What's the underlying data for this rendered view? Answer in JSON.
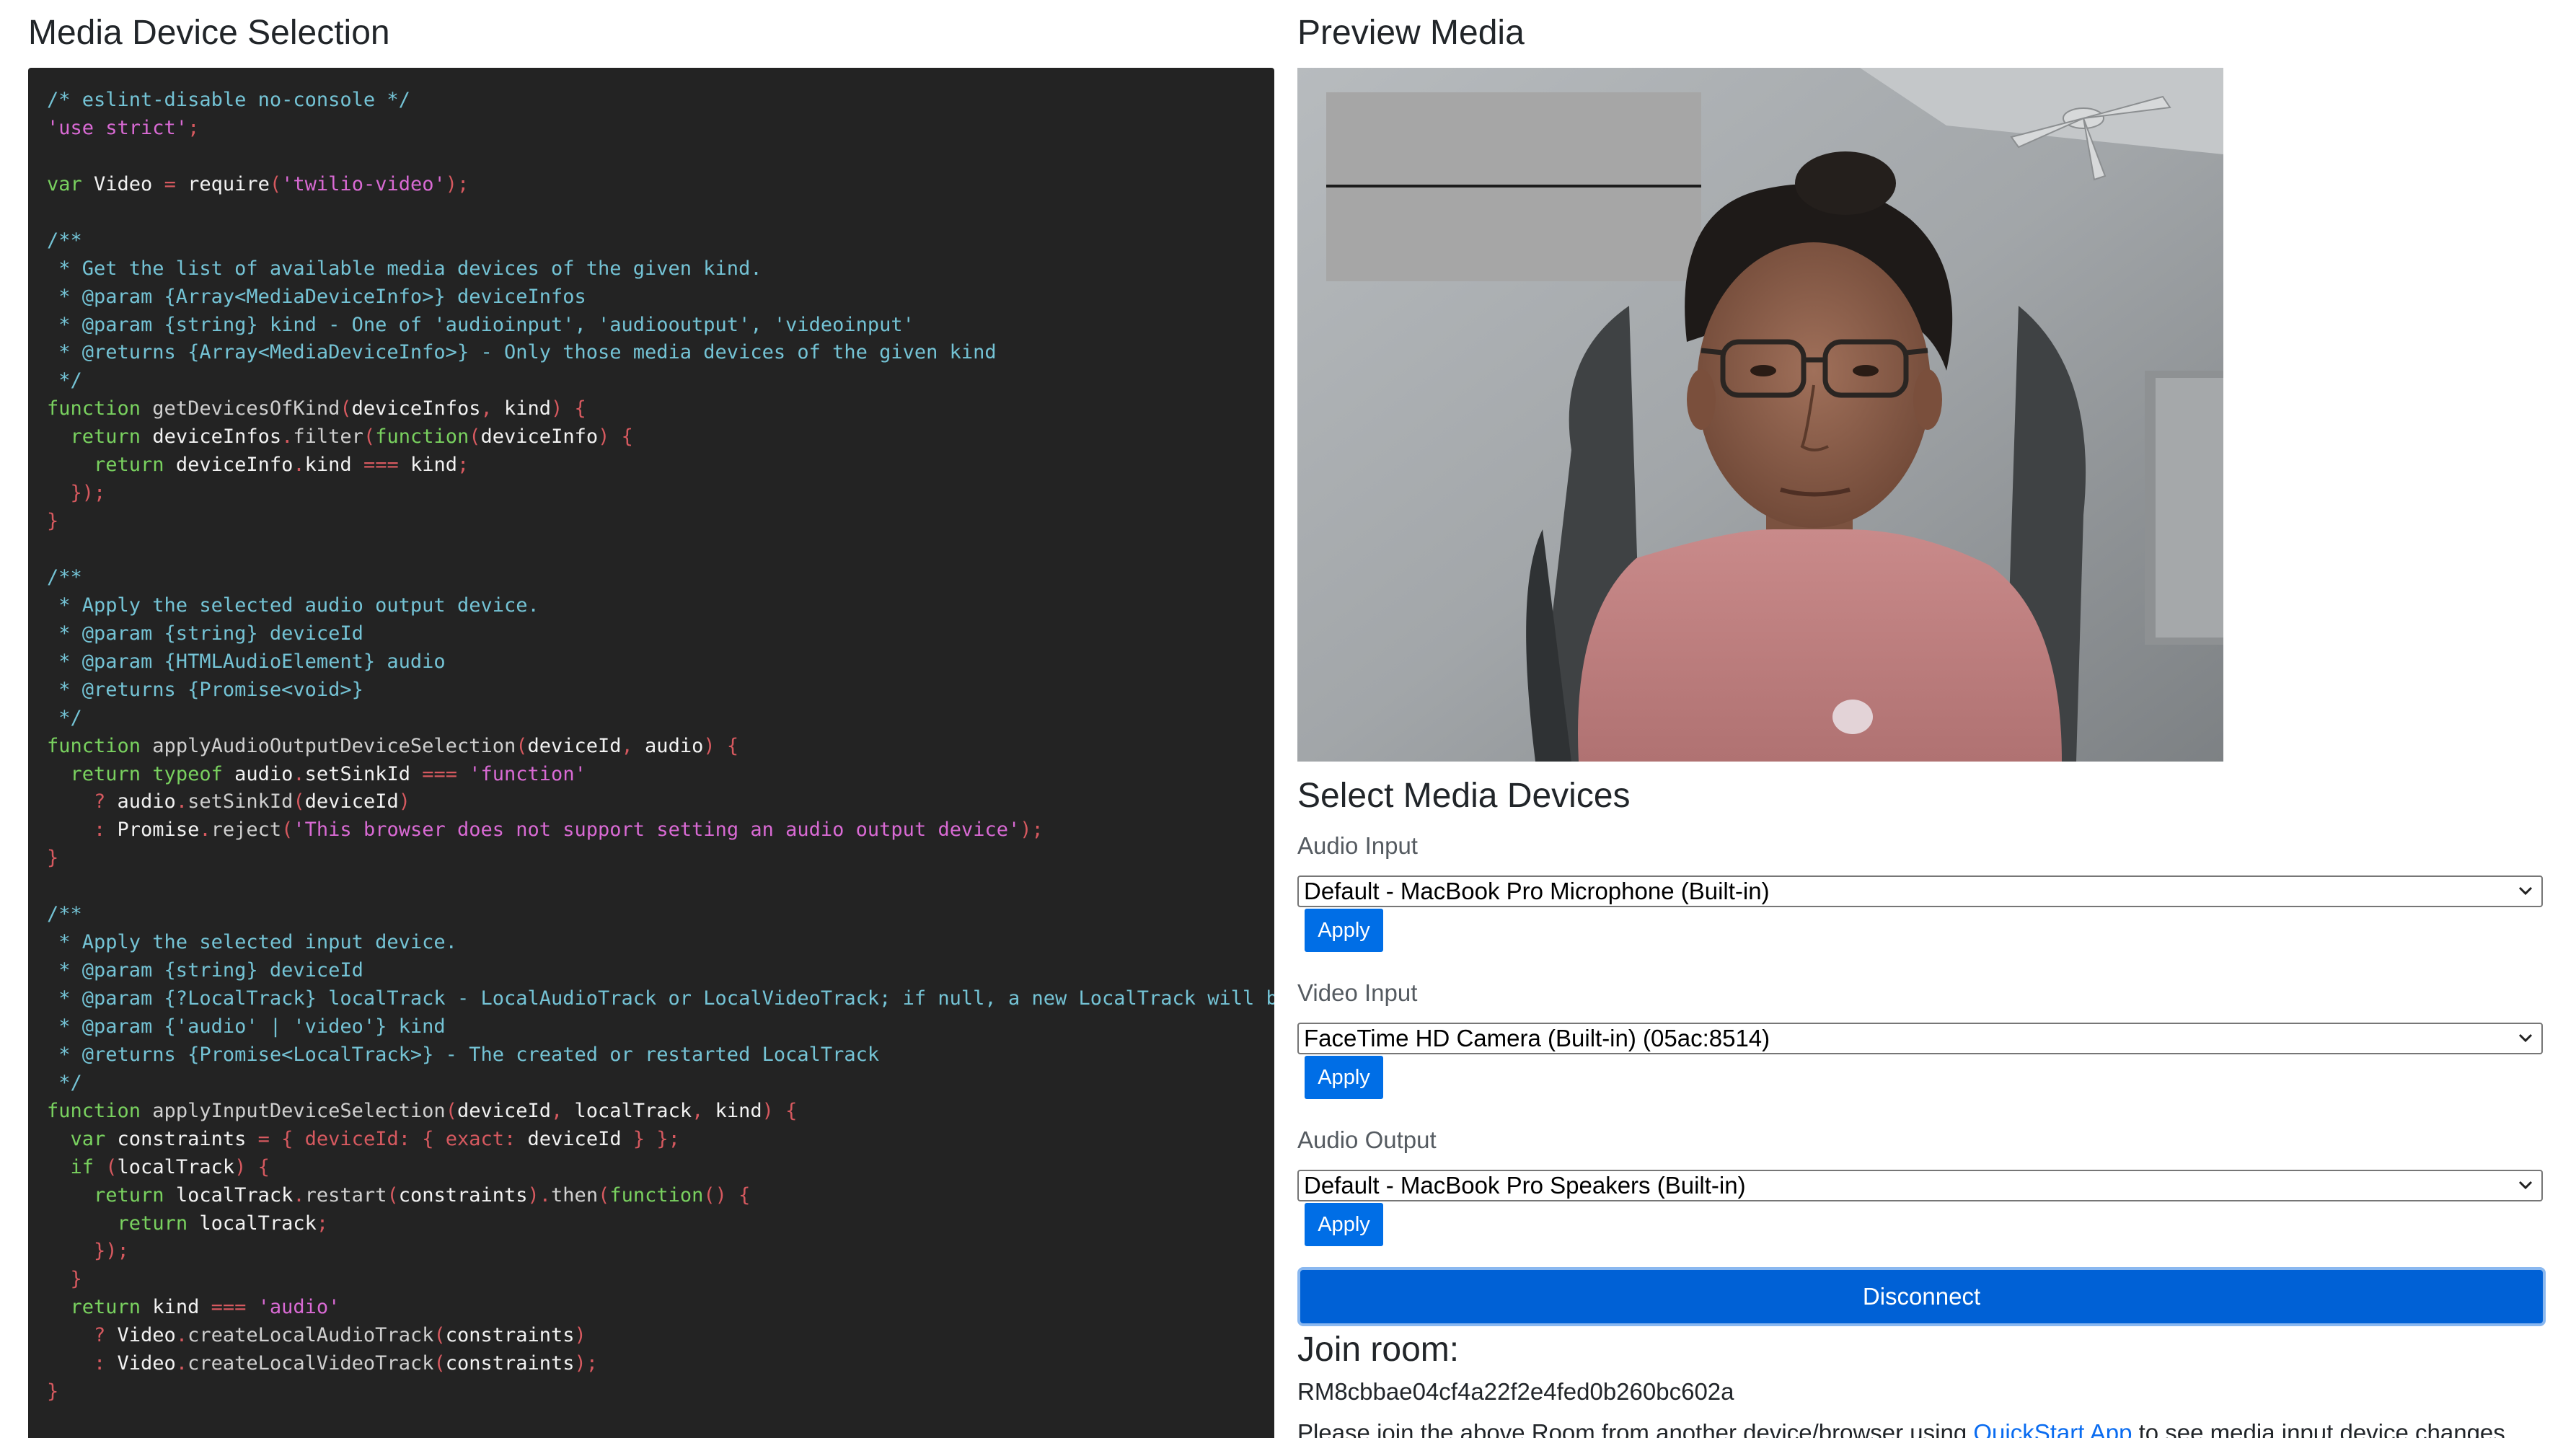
{
  "left": {
    "title": "Media Device Selection",
    "code_lines": [
      [
        [
          "cm",
          "/* eslint-disable no-console */"
        ]
      ],
      [
        [
          "str",
          "'use strict'"
        ],
        [
          "p",
          ";"
        ]
      ],
      [],
      [
        [
          "kw",
          "var"
        ],
        [
          "id",
          " Video "
        ],
        [
          "op",
          "="
        ],
        [
          "id",
          " require"
        ],
        [
          "p",
          "("
        ],
        [
          "str",
          "'twilio-video'"
        ],
        [
          "p",
          ");"
        ]
      ],
      [],
      [
        [
          "cm",
          "/**"
        ]
      ],
      [
        [
          "cm",
          " * Get the list of available media devices of the given kind."
        ]
      ],
      [
        [
          "cm",
          " * @param {Array<MediaDeviceInfo>} deviceInfos"
        ]
      ],
      [
        [
          "cm",
          " * @param {string} kind - One of 'audioinput', 'audiooutput', 'videoinput'"
        ]
      ],
      [
        [
          "cm",
          " * @returns {Array<MediaDeviceInfo>} - Only those media devices of the given kind"
        ]
      ],
      [
        [
          "cm",
          " */"
        ]
      ],
      [
        [
          "kw",
          "function"
        ],
        [
          "fn",
          " getDevicesOfKind"
        ],
        [
          "p",
          "("
        ],
        [
          "id",
          "deviceInfos"
        ],
        [
          "p",
          ","
        ],
        [
          "id",
          " kind"
        ],
        [
          "p",
          ") {"
        ]
      ],
      [
        [
          "id",
          "  "
        ],
        [
          "kw",
          "return"
        ],
        [
          "id",
          " deviceInfos"
        ],
        [
          "p",
          "."
        ],
        [
          "fn",
          "filter"
        ],
        [
          "p",
          "("
        ],
        [
          "kw",
          "function"
        ],
        [
          "p",
          "("
        ],
        [
          "id",
          "deviceInfo"
        ],
        [
          "p",
          ") {"
        ]
      ],
      [
        [
          "id",
          "    "
        ],
        [
          "kw",
          "return"
        ],
        [
          "id",
          " deviceInfo"
        ],
        [
          "p",
          "."
        ],
        [
          "id",
          "kind "
        ],
        [
          "op",
          "==="
        ],
        [
          "id",
          " kind"
        ],
        [
          "p",
          ";"
        ]
      ],
      [
        [
          "p",
          "  });"
        ]
      ],
      [
        [
          "p",
          "}"
        ]
      ],
      [],
      [
        [
          "cm",
          "/**"
        ]
      ],
      [
        [
          "cm",
          " * Apply the selected audio output device."
        ]
      ],
      [
        [
          "cm",
          " * @param {string} deviceId"
        ]
      ],
      [
        [
          "cm",
          " * @param {HTMLAudioElement} audio"
        ]
      ],
      [
        [
          "cm",
          " * @returns {Promise<void>}"
        ]
      ],
      [
        [
          "cm",
          " */"
        ]
      ],
      [
        [
          "kw",
          "function"
        ],
        [
          "fn",
          " applyAudioOutputDeviceSelection"
        ],
        [
          "p",
          "("
        ],
        [
          "id",
          "deviceId"
        ],
        [
          "p",
          ","
        ],
        [
          "id",
          " audio"
        ],
        [
          "p",
          ") {"
        ]
      ],
      [
        [
          "id",
          "  "
        ],
        [
          "kw",
          "return"
        ],
        [
          "kw",
          " typeof"
        ],
        [
          "id",
          " audio"
        ],
        [
          "p",
          "."
        ],
        [
          "id",
          "setSinkId "
        ],
        [
          "op",
          "==="
        ],
        [
          "str",
          " 'function'"
        ]
      ],
      [
        [
          "op",
          "    ?"
        ],
        [
          "id",
          " audio"
        ],
        [
          "p",
          "."
        ],
        [
          "fn",
          "setSinkId"
        ],
        [
          "p",
          "("
        ],
        [
          "id",
          "deviceId"
        ],
        [
          "p",
          ")"
        ]
      ],
      [
        [
          "op",
          "    :"
        ],
        [
          "id",
          " Promise"
        ],
        [
          "p",
          "."
        ],
        [
          "fn",
          "reject"
        ],
        [
          "p",
          "("
        ],
        [
          "str",
          "'This browser does not support setting an audio output device'"
        ],
        [
          "p",
          ");"
        ]
      ],
      [
        [
          "p",
          "}"
        ]
      ],
      [],
      [
        [
          "cm",
          "/**"
        ]
      ],
      [
        [
          "cm",
          " * Apply the selected input device."
        ]
      ],
      [
        [
          "cm",
          " * @param {string} deviceId"
        ]
      ],
      [
        [
          "cm",
          " * @param {?LocalTrack} localTrack - LocalAudioTrack or LocalVideoTrack; if null, a new LocalTrack will be cr"
        ]
      ],
      [
        [
          "cm",
          " * @param {'audio' | 'video'} kind"
        ]
      ],
      [
        [
          "cm",
          " * @returns {Promise<LocalTrack>} - The created or restarted LocalTrack"
        ]
      ],
      [
        [
          "cm",
          " */"
        ]
      ],
      [
        [
          "kw",
          "function"
        ],
        [
          "fn",
          " applyInputDeviceSelection"
        ],
        [
          "p",
          "("
        ],
        [
          "id",
          "deviceId"
        ],
        [
          "p",
          ","
        ],
        [
          "id",
          " localTrack"
        ],
        [
          "p",
          ","
        ],
        [
          "id",
          " kind"
        ],
        [
          "p",
          ") {"
        ]
      ],
      [
        [
          "id",
          "  "
        ],
        [
          "kw",
          "var"
        ],
        [
          "id",
          " constraints "
        ],
        [
          "op",
          "="
        ],
        [
          "p",
          " {"
        ],
        [
          "p",
          " deviceId:"
        ],
        [
          "p",
          " {"
        ],
        [
          "p",
          " exact:"
        ],
        [
          "id",
          " deviceId "
        ],
        [
          "p",
          "} };"
        ]
      ],
      [
        [
          "id",
          "  "
        ],
        [
          "kw",
          "if"
        ],
        [
          "p",
          " ("
        ],
        [
          "id",
          "localTrack"
        ],
        [
          "p",
          ") {"
        ]
      ],
      [
        [
          "id",
          "    "
        ],
        [
          "kw",
          "return"
        ],
        [
          "id",
          " localTrack"
        ],
        [
          "p",
          "."
        ],
        [
          "fn",
          "restart"
        ],
        [
          "p",
          "("
        ],
        [
          "id",
          "constraints"
        ],
        [
          "p",
          ")."
        ],
        [
          "fn",
          "then"
        ],
        [
          "p",
          "("
        ],
        [
          "kw",
          "function"
        ],
        [
          "p",
          "() {"
        ]
      ],
      [
        [
          "id",
          "      "
        ],
        [
          "kw",
          "return"
        ],
        [
          "id",
          " localTrack"
        ],
        [
          "p",
          ";"
        ]
      ],
      [
        [
          "p",
          "    });"
        ]
      ],
      [
        [
          "p",
          "  }"
        ]
      ],
      [
        [
          "id",
          "  "
        ],
        [
          "kw",
          "return"
        ],
        [
          "id",
          " kind "
        ],
        [
          "op",
          "==="
        ],
        [
          "str",
          " 'audio'"
        ]
      ],
      [
        [
          "op",
          "    ?"
        ],
        [
          "id",
          " Video"
        ],
        [
          "p",
          "."
        ],
        [
          "fn",
          "createLocalAudioTrack"
        ],
        [
          "p",
          "("
        ],
        [
          "id",
          "constraints"
        ],
        [
          "p",
          ")"
        ]
      ],
      [
        [
          "op",
          "    :"
        ],
        [
          "id",
          " Video"
        ],
        [
          "p",
          "."
        ],
        [
          "fn",
          "createLocalVideoTrack"
        ],
        [
          "p",
          "("
        ],
        [
          "id",
          "constraints"
        ],
        [
          "p",
          ");"
        ]
      ],
      [
        [
          "p",
          "}"
        ]
      ]
    ]
  },
  "right": {
    "preview_title": "Preview Media",
    "devices_title": "Select Media Devices",
    "audio_input": {
      "label": "Audio Input",
      "selected": "Default - MacBook Pro Microphone (Built-in)",
      "apply_label": "Apply"
    },
    "video_input": {
      "label": "Video Input",
      "selected": "FaceTime HD Camera (Built-in) (05ac:8514)",
      "apply_label": "Apply"
    },
    "audio_output": {
      "label": "Audio Output",
      "selected": "Default - MacBook Pro Speakers (Built-in)",
      "apply_label": "Apply"
    },
    "disconnect_label": "Disconnect",
    "join_title": "Join room:",
    "room_id": "RM8cbbae04cf4a22f2e4fed0b260bc602a",
    "join_note_before": "Please join the above Room from another device/browser using ",
    "join_note_link": "QuickStart App",
    "join_note_after": " to see media input device changes"
  },
  "colors": {
    "code_bg": "#232323",
    "comment": "#74c3d5",
    "keyword": "#79d15f",
    "string": "#d96ad4",
    "punctuation": "#d6595f",
    "button_blue": "#006ee6",
    "link_blue": "#0a6cf0"
  },
  "icons": {
    "select_chevron": "chevron-down-icon"
  }
}
